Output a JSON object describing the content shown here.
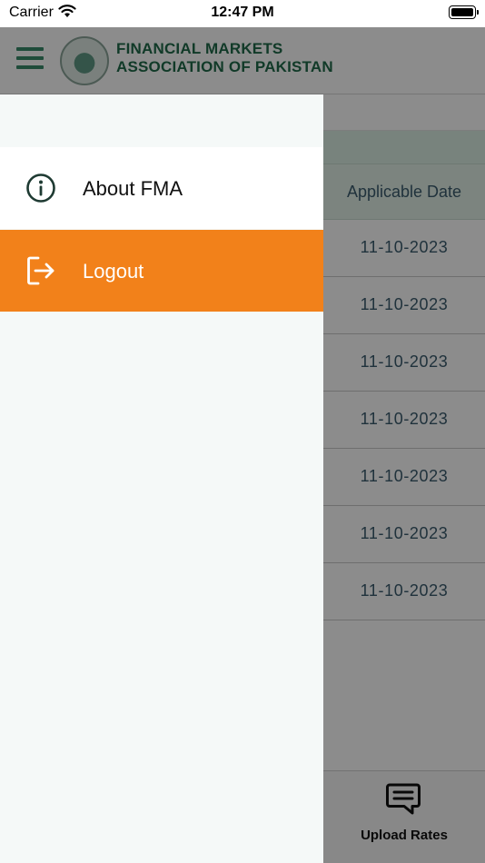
{
  "status_bar": {
    "carrier": "Carrier",
    "time": "12:47 PM"
  },
  "header": {
    "logo_line1": "FINANCIAL MARKETS",
    "logo_line2": "ASSOCIATION OF PAKISTAN",
    "brand_color": "#1f6b4a"
  },
  "table": {
    "column_header": "Applicable Date",
    "rows": [
      {
        "date": "11-10-2023"
      },
      {
        "date": "11-10-2023"
      },
      {
        "date": "11-10-2023"
      },
      {
        "date": "11-10-2023"
      },
      {
        "date": "11-10-2023"
      },
      {
        "date": "11-10-2023"
      },
      {
        "date": "11-10-2023"
      }
    ]
  },
  "bottom_tab": {
    "label": "Upload Rates",
    "icon": "chat-bubble-icon"
  },
  "drawer": {
    "items": [
      {
        "label": "About FMA",
        "icon": "info-icon"
      },
      {
        "label": "Logout",
        "icon": "logout-icon",
        "active": true
      }
    ],
    "active_color": "#f2811a"
  }
}
